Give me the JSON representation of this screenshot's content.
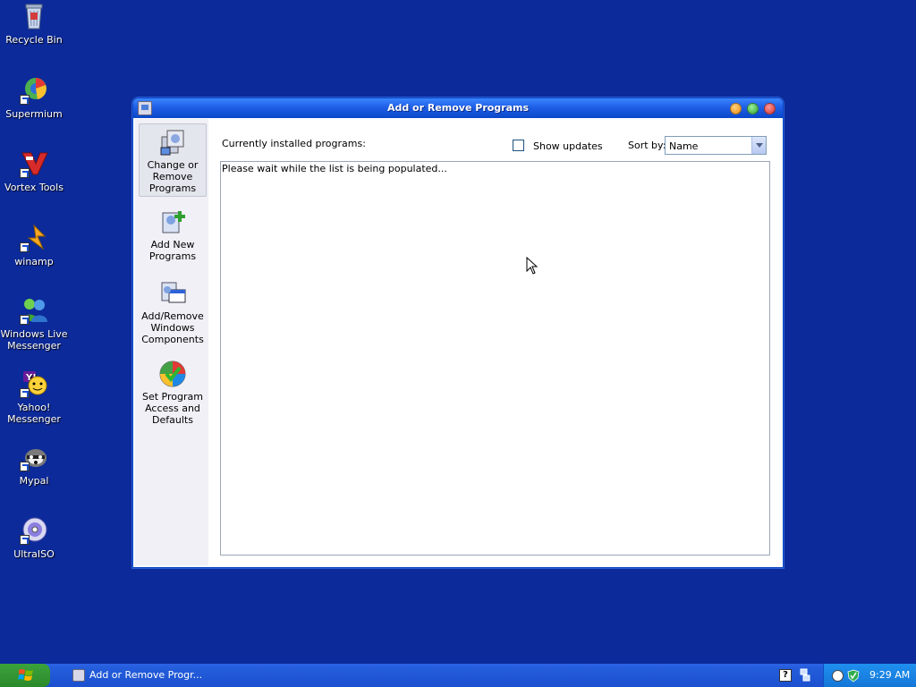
{
  "desktop": {
    "icons": [
      {
        "label": "Recycle Bin",
        "icon": "recycle-bin-icon"
      },
      {
        "label": "Supermium",
        "icon": "supermium-icon"
      },
      {
        "label": "Vortex Tools",
        "icon": "vortex-tools-icon"
      },
      {
        "label": "winamp",
        "icon": "winamp-icon"
      },
      {
        "label": "Windows Live Messenger",
        "icon": "windows-live-messenger-icon"
      },
      {
        "label": "Yahoo! Messenger",
        "icon": "yahoo-messenger-icon"
      },
      {
        "label": "Mypal",
        "icon": "mypal-icon"
      },
      {
        "label": "UltraISO",
        "icon": "ultraiso-icon"
      }
    ],
    "background_color": "#0c2a99"
  },
  "window": {
    "title": "Add or Remove Programs",
    "sidebar": [
      {
        "label": "Change or Remove Programs",
        "icon": "change-remove-programs-icon",
        "selected": true
      },
      {
        "label": "Add New Programs",
        "icon": "add-new-programs-icon",
        "selected": false
      },
      {
        "label": "Add/Remove Windows Components",
        "icon": "windows-components-icon",
        "selected": false
      },
      {
        "label": "Set Program Access and Defaults",
        "icon": "program-access-defaults-icon",
        "selected": false
      }
    ],
    "installed_label": "Currently installed programs:",
    "show_updates_label": "Show updates",
    "show_updates_checked": false,
    "sort_label": "Sort by:",
    "sort_value": "Name",
    "list_status": "Please wait while the list is being populated..."
  },
  "taskbar": {
    "task_item_label": "Add or Remove Progr...",
    "quick_help": "?",
    "clock": "9:29 AM",
    "colors": {
      "taskbar": "#245ddb",
      "start": "#3ba23b",
      "tray": "#1b84e2"
    }
  }
}
